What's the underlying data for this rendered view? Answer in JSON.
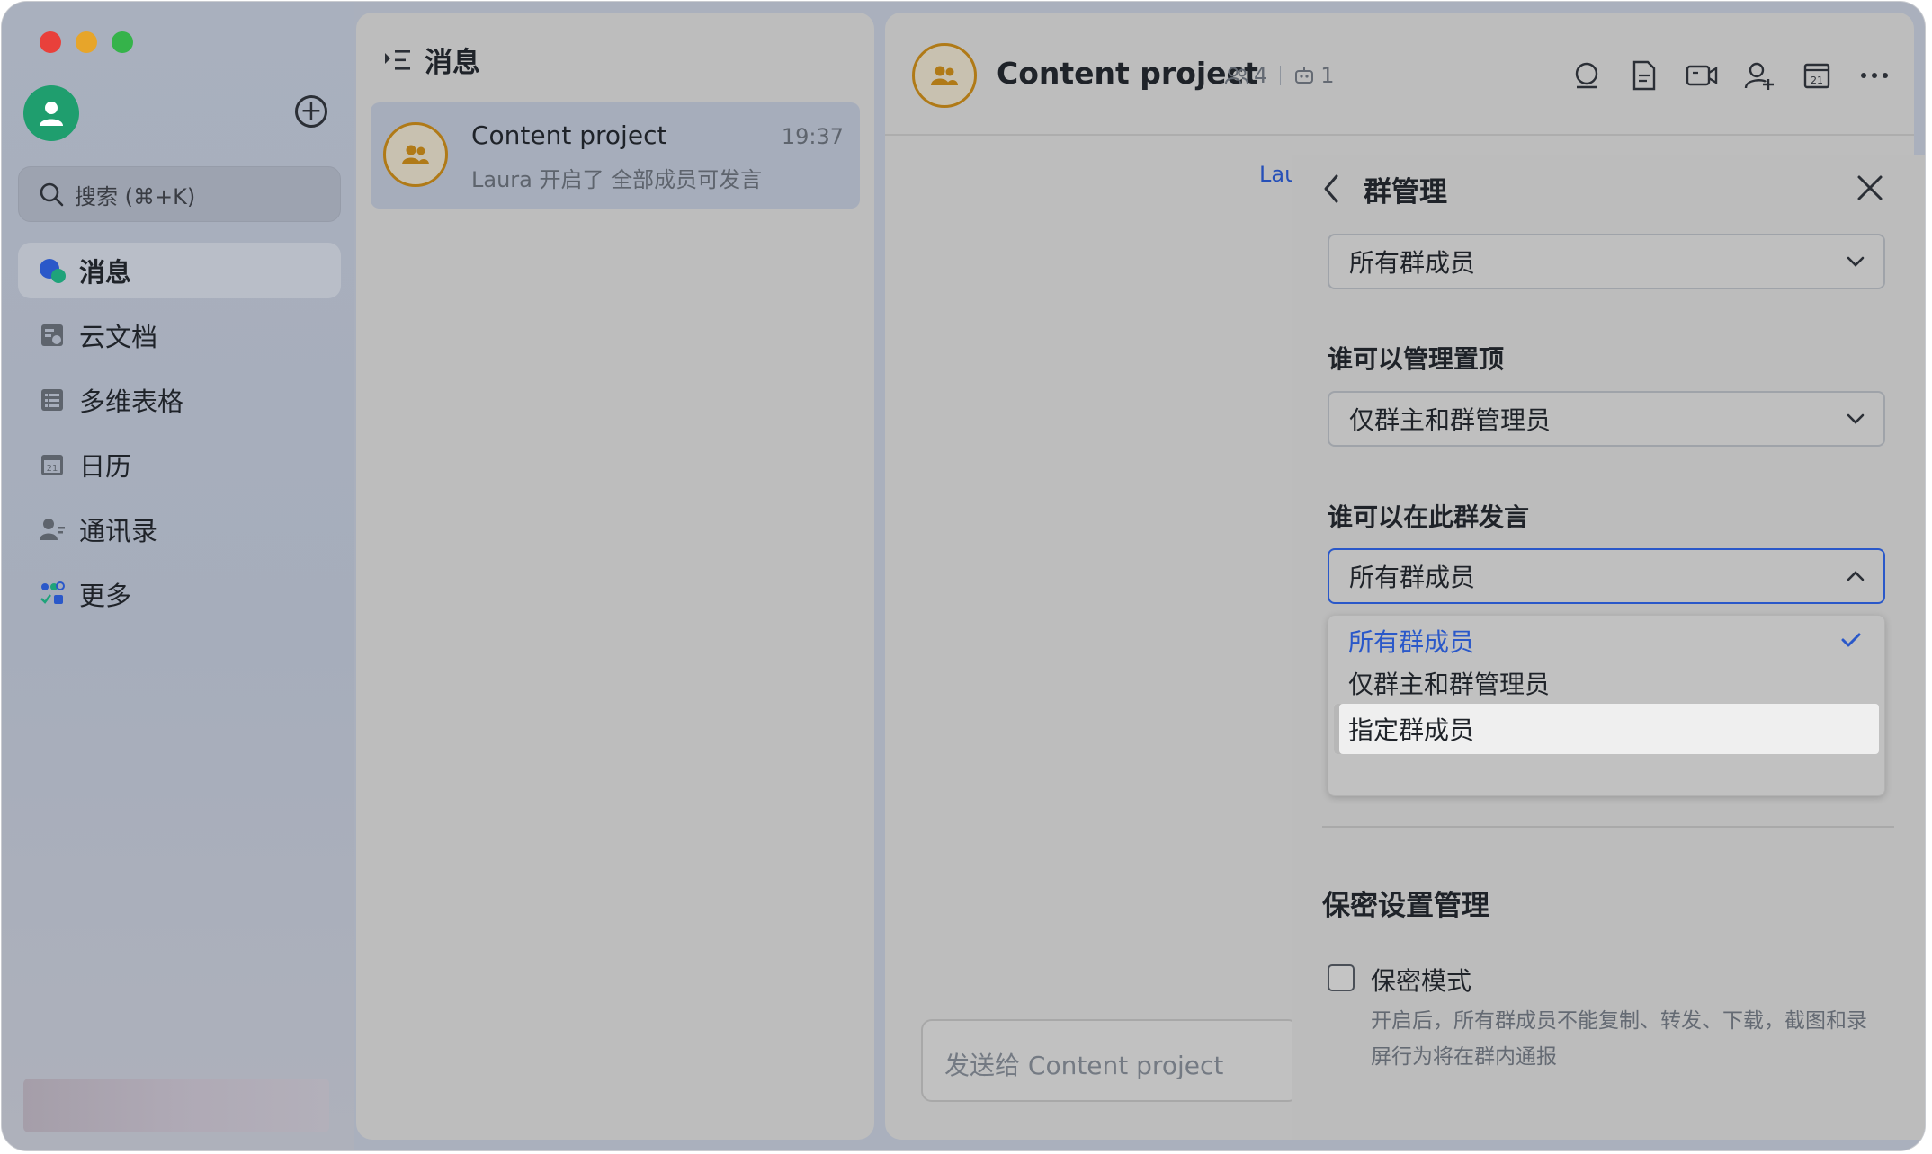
{
  "sidebar": {
    "search_placeholder": "搜索 (⌘+K)",
    "items": [
      {
        "label": "消息",
        "icon": "messages-icon",
        "active": true
      },
      {
        "label": "云文档",
        "icon": "cloud-docs-icon",
        "active": false
      },
      {
        "label": "多维表格",
        "icon": "base-table-icon",
        "active": false
      },
      {
        "label": "日历",
        "icon": "calendar-icon",
        "active": false
      },
      {
        "label": "通讯录",
        "icon": "contacts-icon",
        "active": false
      },
      {
        "label": "更多",
        "icon": "more-apps-icon",
        "active": false
      }
    ]
  },
  "chatlist": {
    "title": "消息",
    "items": [
      {
        "name": "Content project",
        "time": "19:37",
        "preview": "Laura 开启了 全部成员可发言"
      }
    ]
  },
  "main": {
    "title": "Content project",
    "member_count": "4",
    "bot_count": "1",
    "truncated_message": "Lau",
    "compose_placeholder": "发送给 Content project"
  },
  "panel": {
    "title": "群管理",
    "top_select_value": "所有群成员",
    "pin_label": "谁可以管理置顶",
    "pin_value": "仅群主和群管理员",
    "speak_label": "谁可以在此群发言",
    "speak_value": "所有群成员",
    "speak_options": [
      "所有群成员",
      "仅群主和群管理员",
      "指定群成员"
    ],
    "security_title": "保密设置管理",
    "secret_mode_label": "保密模式",
    "secret_mode_desc": "开启后，所有群成员不能复制、转发、下载，截图和录屏行为将在群内通报"
  },
  "colors": {
    "accent": "#2a58c9",
    "group_avatar_ring": "#b07a17",
    "user_avatar": "#1f9e6e"
  }
}
